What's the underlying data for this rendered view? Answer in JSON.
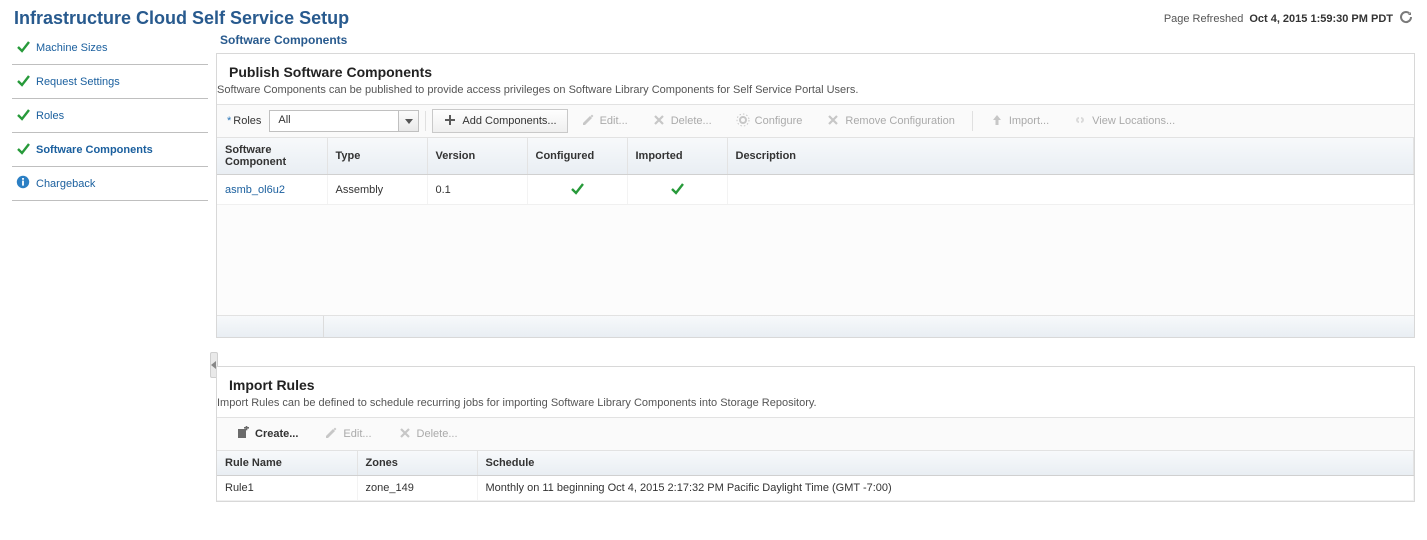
{
  "header": {
    "title": "Infrastructure Cloud Self Service Setup",
    "refresh_prefix": "Page Refreshed",
    "refresh_time": "Oct 4, 2015 1:59:30 PM PDT"
  },
  "sidebar": {
    "items": [
      {
        "label": "Machine Sizes",
        "icon": "check",
        "active": false
      },
      {
        "label": "Request Settings",
        "icon": "check",
        "active": false
      },
      {
        "label": "Roles",
        "icon": "check",
        "active": false
      },
      {
        "label": "Software Components",
        "icon": "check",
        "active": true
      },
      {
        "label": "Chargeback",
        "icon": "info",
        "active": false
      }
    ]
  },
  "crumb": "Software Components",
  "publish": {
    "title": "Publish Software Components",
    "desc": "Software Components can be published to provide access privileges on Software Library Components for Self Service Portal Users.",
    "roles_label": "Roles",
    "roles_value": "All",
    "toolbar": {
      "add": "Add Components...",
      "edit": "Edit...",
      "delete": "Delete...",
      "configure": "Configure",
      "remove": "Remove Configuration",
      "import": "Import...",
      "view": "View Locations..."
    },
    "columns": {
      "c1": "Software Component",
      "c2": "Type",
      "c3": "Version",
      "c4": "Configured",
      "c5": "Imported",
      "c6": "Description"
    },
    "rows": [
      {
        "name": "asmb_ol6u2",
        "type": "Assembly",
        "version": "0.1",
        "configured": true,
        "imported": true,
        "desc": ""
      }
    ]
  },
  "rules": {
    "title": "Import Rules",
    "desc": "Import Rules can be defined to schedule recurring jobs for importing Software Library Components into Storage Repository.",
    "toolbar": {
      "create": "Create...",
      "edit": "Edit...",
      "delete": "Delete..."
    },
    "columns": {
      "c1": "Rule Name",
      "c2": "Zones",
      "c3": "Schedule"
    },
    "rows": [
      {
        "name": "Rule1",
        "zones": "zone_149",
        "schedule": "Monthly on 11 beginning Oct 4, 2015 2:17:32 PM Pacific Daylight Time (GMT -7:00)"
      }
    ]
  }
}
